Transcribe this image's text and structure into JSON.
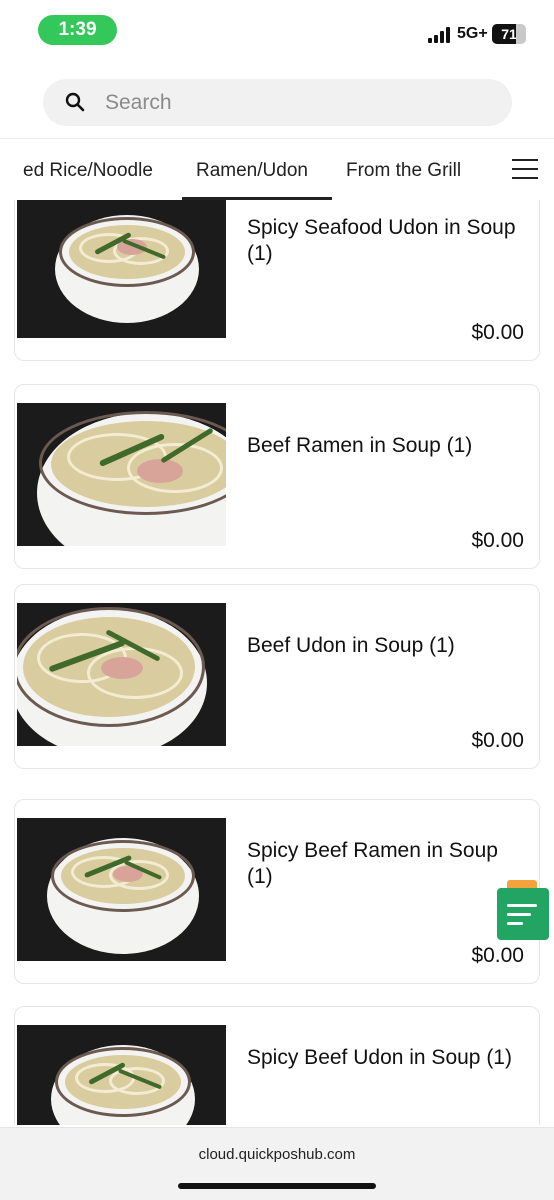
{
  "status": {
    "time": "1:39",
    "network": "5G+",
    "battery": "71",
    "battery_level": 0.71
  },
  "search": {
    "placeholder": "Search",
    "icon": "search-icon"
  },
  "tabs": [
    {
      "label": "ed Rice/Noodle",
      "active": false
    },
    {
      "label": "Ramen/Udon",
      "active": true
    },
    {
      "label": "From the Grill",
      "active": false
    }
  ],
  "menu_icon": "hamburger-menu-icon",
  "items": [
    {
      "name": "Spicy Seafood Udon in Soup (1)",
      "price": "$0.00"
    },
    {
      "name": "Beef Ramen in Soup (1)",
      "price": "$0.00"
    },
    {
      "name": "Beef Udon in Soup (1)",
      "price": "$0.00"
    },
    {
      "name": "Spicy Beef Ramen in Soup (1)",
      "price": "$0.00"
    },
    {
      "name": "Spicy Beef Udon in Soup (1)",
      "price": ""
    }
  ],
  "order_button_icon": "order-list-icon",
  "browser": {
    "url": "cloud.quickposhub.com"
  },
  "colors": {
    "status_pill": "#34c759",
    "order_button": "#22a462",
    "order_button_tab": "#f4a23c"
  }
}
